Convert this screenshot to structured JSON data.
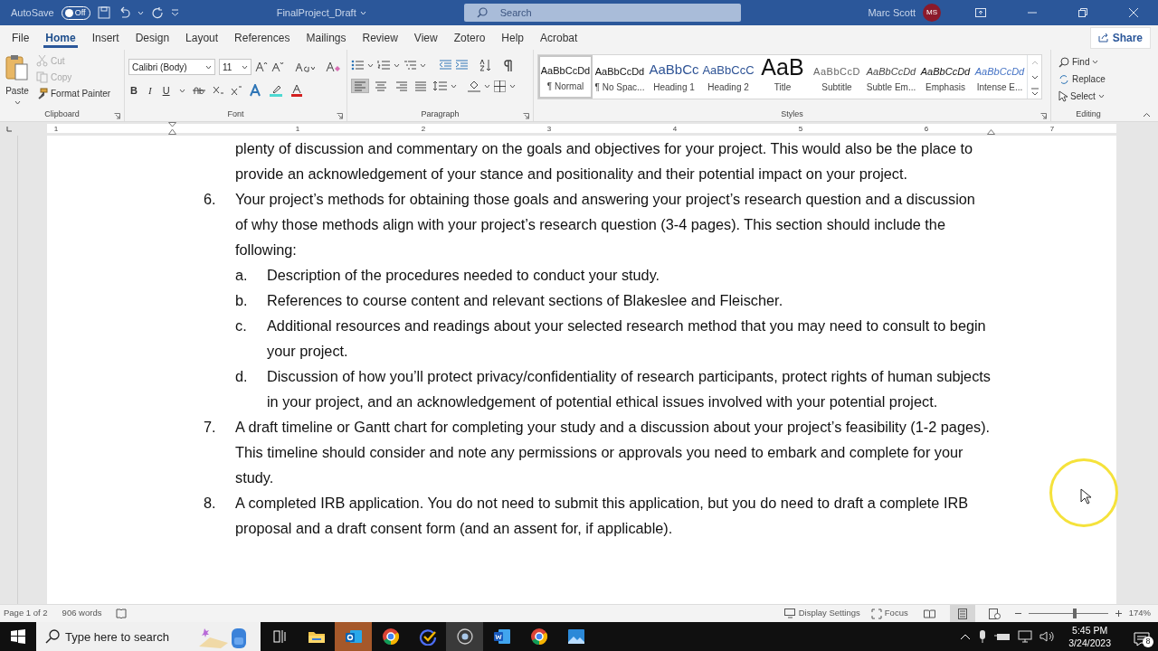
{
  "title_bar": {
    "autosave_label": "AutoSave",
    "autosave": {
      "label": "Off",
      "on": false
    },
    "document_title": "FinalProject_Draft",
    "search_placeholder": "Search",
    "user_name": "Marc Scott",
    "user_initials": "MS"
  },
  "ribbon_tabs": [
    {
      "label": "File",
      "selected": false
    },
    {
      "label": "Home",
      "selected": true
    },
    {
      "label": "Insert",
      "selected": false
    },
    {
      "label": "Design",
      "selected": false
    },
    {
      "label": "Layout",
      "selected": false
    },
    {
      "label": "References",
      "selected": false
    },
    {
      "label": "Mailings",
      "selected": false
    },
    {
      "label": "Review",
      "selected": false
    },
    {
      "label": "View",
      "selected": false
    },
    {
      "label": "Zotero",
      "selected": false
    },
    {
      "label": "Help",
      "selected": false
    },
    {
      "label": "Acrobat",
      "selected": false
    }
  ],
  "share_button": "Share",
  "clipboard": {
    "paste": "Paste",
    "actions": [
      {
        "label": "Cut",
        "kind": "cut",
        "disabled": true
      },
      {
        "label": "Copy",
        "kind": "copy",
        "disabled": true
      },
      {
        "label": "Format Painter",
        "kind": "painter",
        "disabled": false
      }
    ],
    "group_label": "Clipboard"
  },
  "font": {
    "family": "Calibri (Body)",
    "size": "11",
    "format_buttons": [
      "B",
      "I",
      "U"
    ],
    "group_label": "Font"
  },
  "paragraph": {
    "alignments": [
      {
        "kind": "left",
        "selected": true
      },
      {
        "kind": "center",
        "selected": false
      },
      {
        "kind": "right",
        "selected": false
      },
      {
        "kind": "justify",
        "selected": false
      }
    ],
    "group_label": "Paragraph"
  },
  "styles": {
    "items": [
      {
        "kind": "normal",
        "sample": "AaBbCcDd",
        "name": "¶ Normal",
        "selected": true
      },
      {
        "kind": "nospacing",
        "sample": "AaBbCcDd",
        "name": "¶ No Spac...",
        "selected": false
      },
      {
        "kind": "heading1",
        "sample": "AaBbCc",
        "name": "Heading 1",
        "selected": false
      },
      {
        "kind": "heading2",
        "sample": "AaBbCcC",
        "name": "Heading 2",
        "selected": false
      },
      {
        "kind": "title",
        "sample": "AaB",
        "name": "Title",
        "selected": false
      },
      {
        "kind": "subtitle",
        "sample": "AaBbCcD",
        "name": "Subtitle",
        "selected": false
      },
      {
        "kind": "subtle",
        "sample": "AaBbCcDd",
        "name": "Subtle Em...",
        "selected": false
      },
      {
        "kind": "emphasis",
        "sample": "AaBbCcDd",
        "name": "Emphasis",
        "selected": false
      },
      {
        "kind": "intense",
        "sample": "AaBbCcDd",
        "name": "Intense E...",
        "selected": false
      }
    ],
    "group_label": "Styles"
  },
  "editing": {
    "actions": [
      {
        "kind": "find",
        "label": "Find"
      },
      {
        "kind": "replace",
        "label": "Replace"
      },
      {
        "kind": "select",
        "label": "Select"
      }
    ],
    "group_label": "Editing"
  },
  "ruler_numbers": [
    "1",
    "1",
    "2",
    "3",
    "4",
    "5",
    "6",
    "7"
  ],
  "document": [
    {
      "kind": "continuation",
      "text": "plenty of discussion and commentary on the goals and objectives for your project. This would also be the place to provide an acknowledgement of your stance and positionality and their potential impact on your project."
    },
    {
      "kind": "item",
      "marker": "6.",
      "text": "Your project’s methods for obtaining those goals and answering your project’s research question and a discussion of why those methods align with your project’s research question (3-4 pages). This section should include the following:",
      "children": [
        {
          "kind": "item",
          "marker": "a.",
          "text": "Description of the procedures needed to conduct your study."
        },
        {
          "kind": "item",
          "marker": "b.",
          "text": "References to course content and relevant sections of Blakeslee and Fleischer."
        },
        {
          "kind": "item",
          "marker": "c.",
          "text": "Additional resources and readings about your selected research method that you may need to consult to begin your project."
        },
        {
          "kind": "item",
          "marker": "d.",
          "text": "Discussion of how you’ll protect privacy/confidentiality of research participants, protect rights of human subjects in your project, and an acknowledgement of potential ethical issues involved with your potential project."
        }
      ]
    },
    {
      "kind": "item",
      "marker": "7.",
      "text": "A draft timeline or Gantt chart for completing your study and a discussion about your project’s feasibility (1-2 pages). This timeline should consider and note any permissions or approvals you need to embark and complete for your study."
    },
    {
      "kind": "item",
      "marker": "8.",
      "text": "A completed IRB application. You do not need to submit this application, but you do need to draft a complete IRB proposal and a draft consent form (and an assent for, if applicable)."
    }
  ],
  "status_bar": {
    "page": "Page 1 of 2",
    "words": "906 words",
    "display_settings": "Display Settings",
    "focus": "Focus",
    "views": [
      {
        "kind": "read",
        "selected": false
      },
      {
        "kind": "print",
        "selected": true
      },
      {
        "kind": "web",
        "selected": false
      }
    ],
    "zoom": {
      "level": 0.58,
      "reading": "174%"
    }
  },
  "taskbar": {
    "search_placeholder": "Type here to search",
    "apps": [
      {
        "kind": "taskview",
        "selected": false
      },
      {
        "kind": "explorer",
        "selected": false
      },
      {
        "kind": "outlook",
        "selected": true
      },
      {
        "kind": "chrome",
        "selected": false
      },
      {
        "kind": "tasks",
        "selected": false
      },
      {
        "kind": "recorder",
        "selected": true
      },
      {
        "kind": "word",
        "selected": false
      },
      {
        "kind": "chrome",
        "selected": false
      },
      {
        "kind": "photos",
        "selected": false
      }
    ],
    "time": "5:45 PM",
    "date": "3/24/2023",
    "notifications": "8"
  }
}
